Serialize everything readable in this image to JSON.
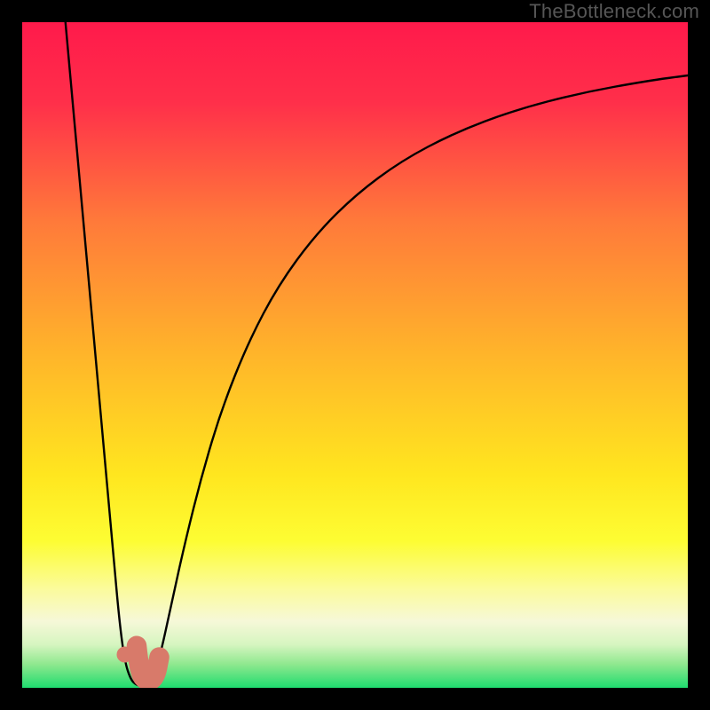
{
  "watermark": "TheBottleneck.com",
  "chart_data": {
    "type": "line",
    "title": "",
    "xlabel": "",
    "ylabel": "",
    "xlim": [
      0,
      100
    ],
    "ylim": [
      0,
      100
    ],
    "grid": false,
    "legend": false,
    "background_gradient": {
      "stops": [
        {
          "pos": 0.0,
          "color": "#ff1a4b"
        },
        {
          "pos": 0.12,
          "color": "#ff2f4a"
        },
        {
          "pos": 0.3,
          "color": "#ff7a3a"
        },
        {
          "pos": 0.5,
          "color": "#ffb52a"
        },
        {
          "pos": 0.68,
          "color": "#ffe61f"
        },
        {
          "pos": 0.78,
          "color": "#fdfd33"
        },
        {
          "pos": 0.85,
          "color": "#fbfb9a"
        },
        {
          "pos": 0.9,
          "color": "#f6f8d8"
        },
        {
          "pos": 0.935,
          "color": "#d6f5c0"
        },
        {
          "pos": 0.965,
          "color": "#8ee88e"
        },
        {
          "pos": 1.0,
          "color": "#1fdc6f"
        }
      ]
    },
    "series": [
      {
        "name": "bottleneck-curve",
        "stroke": "#000000",
        "stroke_width": 2.4,
        "points": [
          {
            "x": 6.5,
            "y": 100.0
          },
          {
            "x": 7.4,
            "y": 90.0
          },
          {
            "x": 8.3,
            "y": 80.0
          },
          {
            "x": 9.2,
            "y": 70.0
          },
          {
            "x": 10.1,
            "y": 60.0
          },
          {
            "x": 11.0,
            "y": 50.0
          },
          {
            "x": 11.9,
            "y": 40.0
          },
          {
            "x": 12.8,
            "y": 30.0
          },
          {
            "x": 13.7,
            "y": 20.0
          },
          {
            "x": 14.6,
            "y": 10.0
          },
          {
            "x": 15.4,
            "y": 4.0
          },
          {
            "x": 16.3,
            "y": 1.2
          },
          {
            "x": 17.2,
            "y": 0.4
          },
          {
            "x": 18.1,
            "y": 0.2
          },
          {
            "x": 19.0,
            "y": 0.6
          },
          {
            "x": 19.9,
            "y": 2.0
          },
          {
            "x": 21.0,
            "y": 6.0
          },
          {
            "x": 22.5,
            "y": 13.0
          },
          {
            "x": 24.5,
            "y": 22.0
          },
          {
            "x": 27.0,
            "y": 32.0
          },
          {
            "x": 30.0,
            "y": 42.0
          },
          {
            "x": 34.0,
            "y": 52.0
          },
          {
            "x": 38.5,
            "y": 60.5
          },
          {
            "x": 44.0,
            "y": 68.0
          },
          {
            "x": 50.0,
            "y": 74.0
          },
          {
            "x": 57.0,
            "y": 79.2
          },
          {
            "x": 65.0,
            "y": 83.4
          },
          {
            "x": 74.0,
            "y": 86.8
          },
          {
            "x": 84.0,
            "y": 89.4
          },
          {
            "x": 94.0,
            "y": 91.2
          },
          {
            "x": 100.0,
            "y": 92.0
          }
        ]
      }
    ],
    "markers": [
      {
        "name": "dot-marker",
        "shape": "circle",
        "color": "#d87a6a",
        "x": 15.4,
        "y": 5.0,
        "r": 1.2
      },
      {
        "name": "hook-marker",
        "shape": "hook",
        "color": "#d87a6a",
        "x": 18.0,
        "y": 2.0,
        "stroke_width": 3.0,
        "path_rel": [
          {
            "x": 17.2,
            "y": 6.3
          },
          {
            "x": 17.6,
            "y": 2.3
          },
          {
            "x": 18.7,
            "y": 0.9
          },
          {
            "x": 20.0,
            "y": 1.5
          },
          {
            "x": 20.6,
            "y": 4.6
          }
        ]
      }
    ]
  }
}
